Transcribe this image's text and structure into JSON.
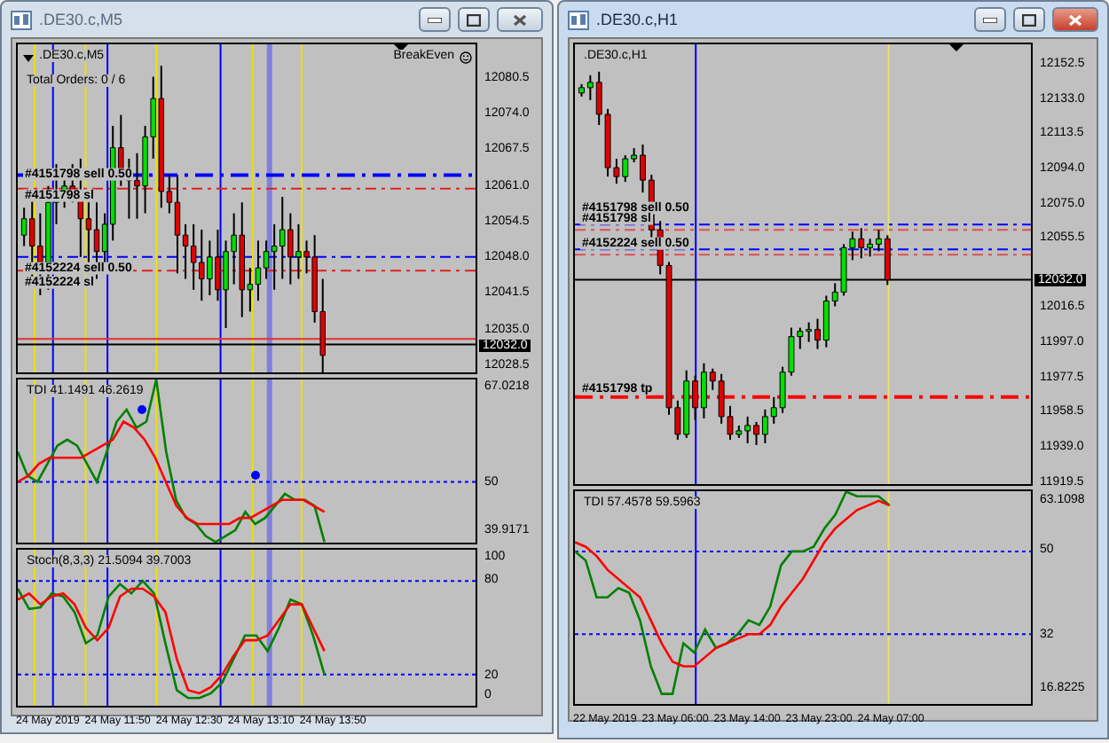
{
  "windows": [
    {
      "title": ".DE30.c,M5",
      "active": false,
      "chart_label": ".DE30.c,M5",
      "total_orders": "Total Orders: 0 / 6",
      "breakeven": "BreakEven",
      "price_ticks": [
        "12080.5",
        "12074.0",
        "12067.5",
        "12061.0",
        "12054.5",
        "12048.0",
        "12041.5",
        "12035.0",
        "12028.5"
      ],
      "current_price": "12032.0",
      "order_labels": [
        "#4151798 sell 0.50",
        "#4151798 sl",
        "#4152224 sell 0.50",
        "#4152224 sl"
      ],
      "indicators": [
        {
          "label": "TDI 41.1491 46.2619",
          "ticks": [
            "67.0218",
            "50",
            "39.9171"
          ]
        },
        {
          "label": "Stoch(8,3,3) 21.5094 39.7003",
          "ticks": [
            "100",
            "80",
            "20",
            "0"
          ]
        }
      ],
      "time_labels": [
        "24 May 2019",
        "24 May 11:50",
        "24 May 12:30",
        "24 May 13:10",
        "24 May 13:50"
      ]
    },
    {
      "title": ".DE30.c,H1",
      "active": true,
      "chart_label": ".DE30.c,H1",
      "price_ticks": [
        "12152.5",
        "12133.0",
        "12113.5",
        "12094.0",
        "12075.0",
        "12055.5",
        "12016.5",
        "11997.0",
        "11977.5",
        "11958.5",
        "11939.0",
        "11919.5"
      ],
      "current_price": "12032.0",
      "order_labels": [
        "#4151798 sell 0.50",
        "#4151798 sl",
        "#4152224 sell 0.50",
        "#4151798 tp"
      ],
      "indicators": [
        {
          "label": "TDI 57.4578 59.5963",
          "ticks": [
            "63.1098",
            "50",
            "32",
            "16.8225"
          ]
        }
      ],
      "time_labels": [
        "22 May 2019",
        "23 May 06:00",
        "23 May 14:00",
        "23 May 23:00",
        "24 May 07:00"
      ]
    }
  ]
}
